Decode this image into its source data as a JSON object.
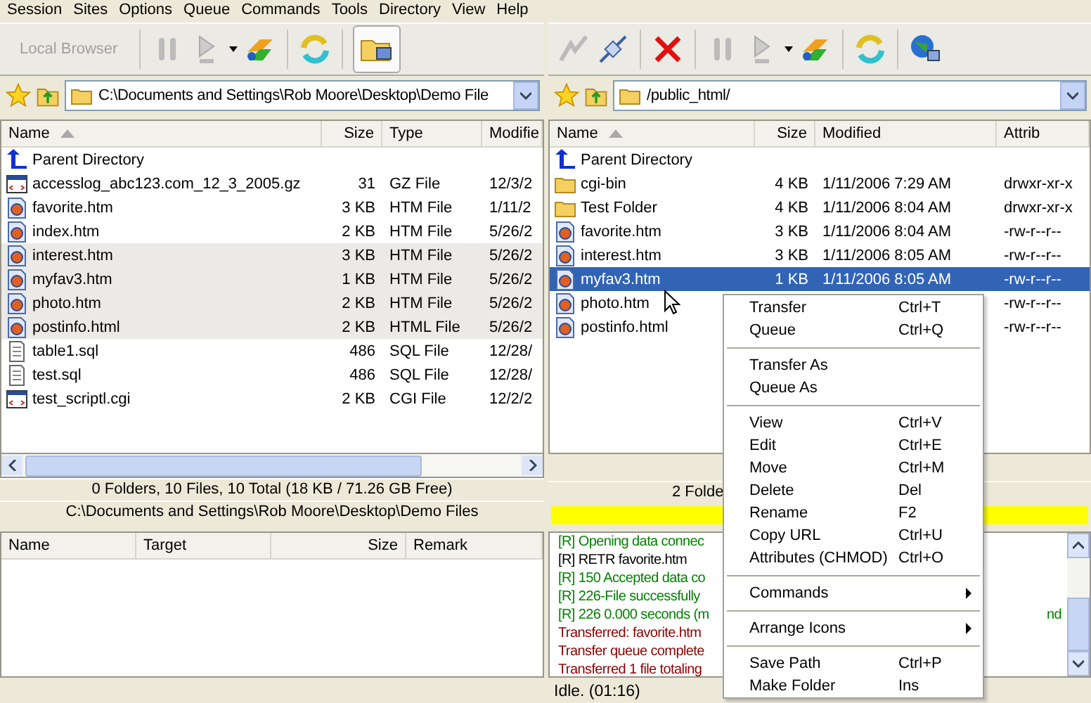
{
  "menu_bar": [
    "Session",
    "Sites",
    "Options",
    "Queue",
    "Commands",
    "Tools",
    "Directory",
    "View",
    "Help"
  ],
  "local": {
    "toolbar_label": "Local Browser",
    "path": "C:\\Documents and Settings\\Rob Moore\\Desktop\\Demo File",
    "columns": [
      "Name",
      "Size",
      "Type",
      "Modifie"
    ],
    "rows": [
      {
        "kind": "parent",
        "name": "Parent Directory",
        "selected": false
      },
      {
        "kind": "archive",
        "name": "accesslog_abc123.com_12_3_2005.gz",
        "size": "31",
        "type": "GZ File",
        "modified": "12/3/2",
        "selected": false
      },
      {
        "kind": "web",
        "name": "favorite.htm",
        "size": "3 KB",
        "type": "HTM File",
        "modified": "1/11/2",
        "selected": false
      },
      {
        "kind": "web",
        "name": "index.htm",
        "size": "2 KB",
        "type": "HTM File",
        "modified": "5/26/2",
        "selected": false
      },
      {
        "kind": "web",
        "name": "interest.htm",
        "size": "3 KB",
        "type": "HTM File",
        "modified": "5/26/2",
        "selected": true
      },
      {
        "kind": "web",
        "name": "myfav3.htm",
        "size": "1 KB",
        "type": "HTM File",
        "modified": "5/26/2",
        "selected": true
      },
      {
        "kind": "web",
        "name": "photo.htm",
        "size": "2 KB",
        "type": "HTM File",
        "modified": "5/26/2",
        "selected": true
      },
      {
        "kind": "web",
        "name": "postinfo.html",
        "size": "2 KB",
        "type": "HTML File",
        "modified": "5/26/2",
        "selected": true
      },
      {
        "kind": "text",
        "name": "table1.sql",
        "size": "486",
        "type": "SQL File",
        "modified": "12/28/",
        "selected": false
      },
      {
        "kind": "text",
        "name": "test.sql",
        "size": "486",
        "type": "SQL File",
        "modified": "12/28/",
        "selected": false
      },
      {
        "kind": "archive",
        "name": "test_scriptl.cgi",
        "size": "2 KB",
        "type": "CGI File",
        "modified": "12/2/2",
        "selected": false
      }
    ],
    "summary": "0 Folders, 10 Files, 10 Total (18 KB / 71.26 GB Free)",
    "status_path": "C:\\Documents and Settings\\Rob Moore\\Desktop\\Demo Files"
  },
  "remote": {
    "path": "/public_html/",
    "columns": [
      "Name",
      "Size",
      "Modified",
      "Attrib"
    ],
    "rows": [
      {
        "kind": "parent",
        "name": "Parent Directory",
        "selected": false
      },
      {
        "kind": "folder",
        "name": "cgi-bin",
        "size": "4 KB",
        "modified": "1/11/2006 7:29 AM",
        "attrib": "drwxr-xr-x",
        "selected": false
      },
      {
        "kind": "folder",
        "name": "Test Folder",
        "size": "4 KB",
        "modified": "1/11/2006 8:04 AM",
        "attrib": "drwxr-xr-x",
        "selected": false
      },
      {
        "kind": "web",
        "name": "favorite.htm",
        "size": "3 KB",
        "modified": "1/11/2006 8:04 AM",
        "attrib": "-rw-r--r--",
        "selected": false
      },
      {
        "kind": "web",
        "name": "interest.htm",
        "size": "3 KB",
        "modified": "1/11/2006 8:05 AM",
        "attrib": "-rw-r--r--",
        "selected": false
      },
      {
        "kind": "web",
        "name": "myfav3.htm",
        "size": "1 KB",
        "modified": "1/11/2006 8:05 AM",
        "attrib": "-rw-r--r--",
        "selected": true
      },
      {
        "kind": "web",
        "name": "photo.htm",
        "attrib": "-rw-r--r--",
        "selected": false
      },
      {
        "kind": "web",
        "name": "postinfo.html",
        "attrib": "-rw-r--r--",
        "selected": false
      }
    ],
    "summary": "2 Folde",
    "progress": {
      "level": 1
    }
  },
  "queue": {
    "columns": [
      "Name",
      "Target",
      "Size",
      "Remark"
    ]
  },
  "log": [
    {
      "kind": "response",
      "text": "[R] Opening data connec"
    },
    {
      "kind": "command",
      "text": "[R] RETR favorite.htm"
    },
    {
      "kind": "response",
      "text": "[R] 150 Accepted data co"
    },
    {
      "kind": "response",
      "text": "[R] 226-File successfully"
    },
    {
      "kind": "response",
      "text": "[R] 226 0.000 seconds (m",
      "tail": "nd"
    },
    {
      "kind": "status",
      "text": "Transferred: favorite.htm"
    },
    {
      "kind": "status",
      "text": "Transfer queue complete"
    },
    {
      "kind": "status",
      "text": "Transferred 1 file totaling"
    }
  ],
  "status_bar": "Idle. (01:16)",
  "context_menu": [
    {
      "kind": "item",
      "label": "Transfer",
      "shortcut": "Ctrl+T"
    },
    {
      "kind": "item",
      "label": "Queue",
      "shortcut": "Ctrl+Q"
    },
    {
      "kind": "separator"
    },
    {
      "kind": "item",
      "label": "Transfer As"
    },
    {
      "kind": "item",
      "label": "Queue As"
    },
    {
      "kind": "separator"
    },
    {
      "kind": "item",
      "label": "View",
      "shortcut": "Ctrl+V"
    },
    {
      "kind": "item",
      "label": "Edit",
      "shortcut": "Ctrl+E"
    },
    {
      "kind": "item",
      "label": "Move",
      "shortcut": "Ctrl+M"
    },
    {
      "kind": "item",
      "label": "Delete",
      "shortcut": "Del"
    },
    {
      "kind": "item",
      "label": "Rename",
      "shortcut": "F2"
    },
    {
      "kind": "item",
      "label": "Copy URL",
      "shortcut": "Ctrl+U"
    },
    {
      "kind": "item",
      "label": "Attributes (CHMOD)",
      "shortcut": "Ctrl+O"
    },
    {
      "kind": "separator"
    },
    {
      "kind": "submenu",
      "label": "Commands"
    },
    {
      "kind": "separator"
    },
    {
      "kind": "submenu",
      "label": "Arrange Icons"
    },
    {
      "kind": "separator"
    },
    {
      "kind": "item",
      "label": "Save Path",
      "shortcut": "Ctrl+P"
    },
    {
      "kind": "item",
      "label": "Make Folder",
      "shortcut": "Ins"
    }
  ]
}
